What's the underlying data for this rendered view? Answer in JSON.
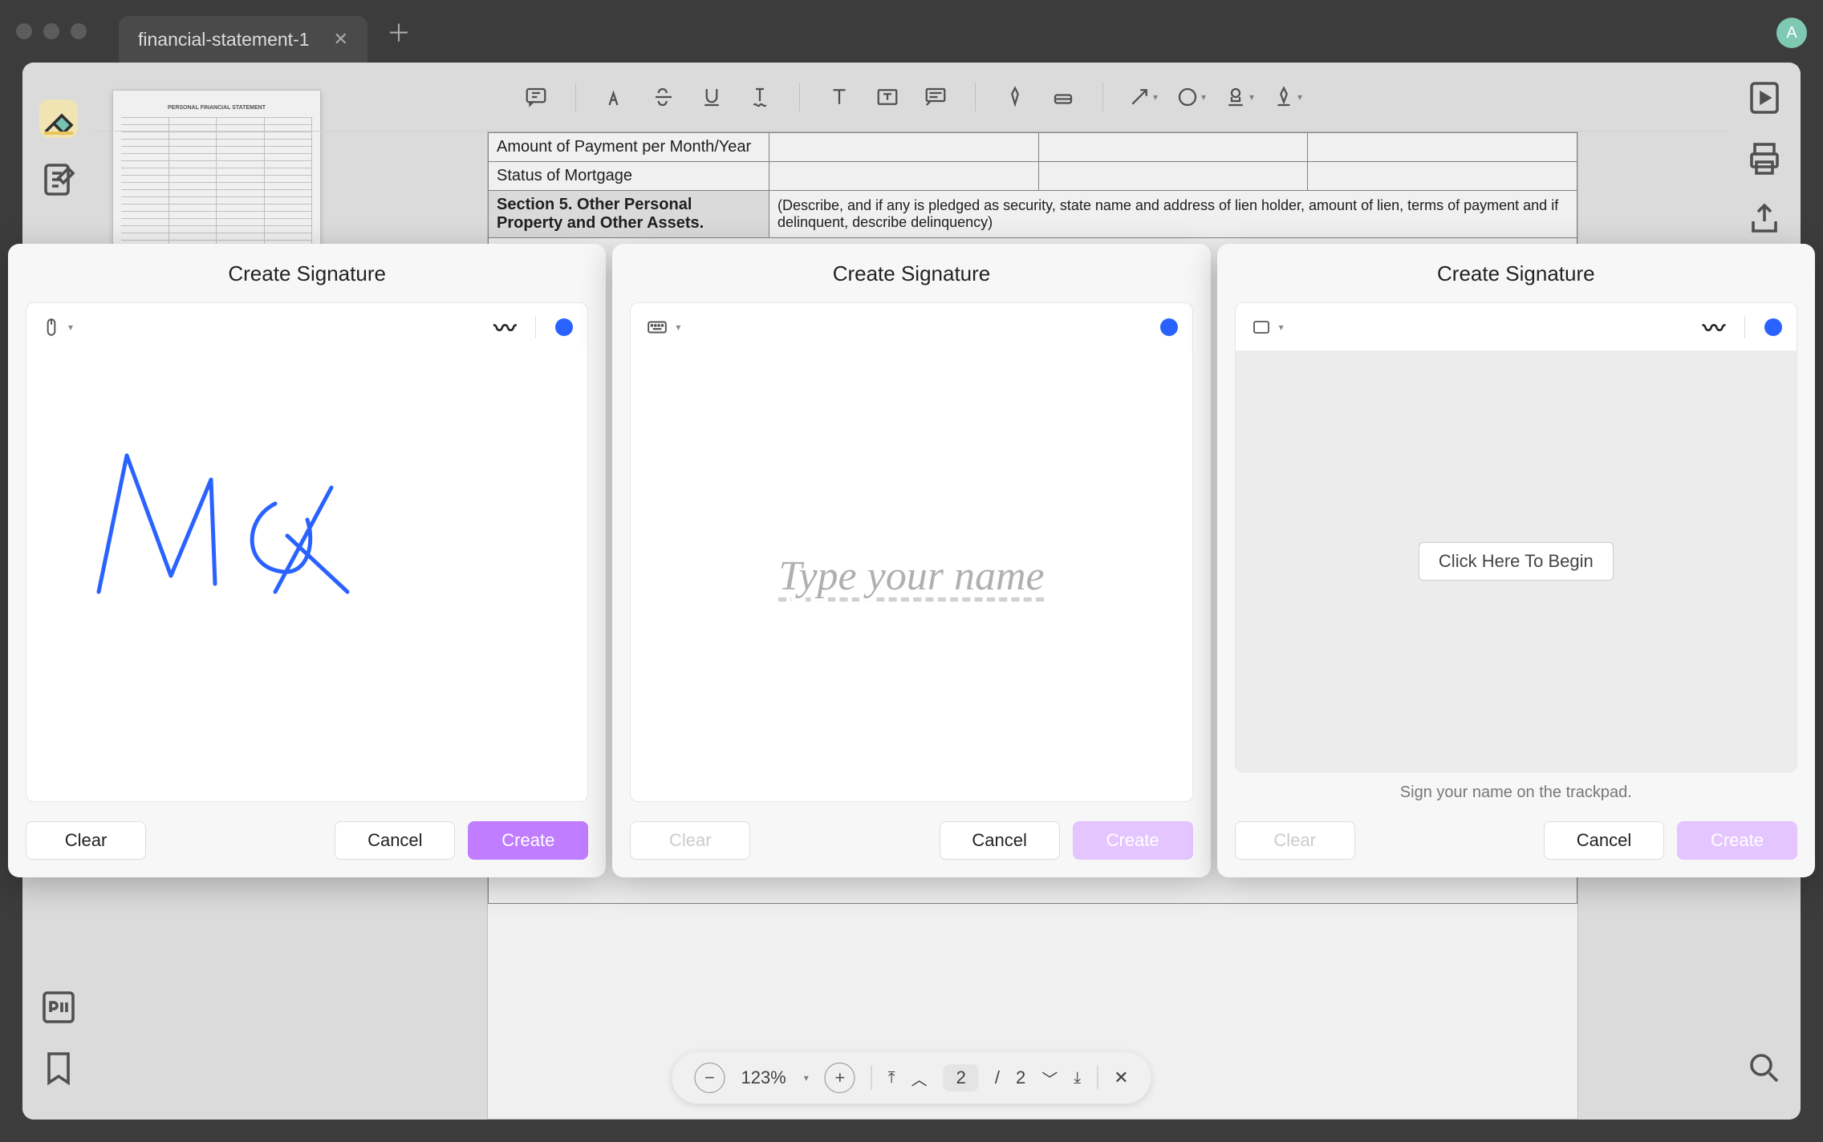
{
  "window": {
    "tab_title": "financial-statement-1",
    "avatar_letter": "A"
  },
  "document": {
    "rows": [
      "Amount of Payment per Month/Year",
      "Status of Mortgage"
    ],
    "section_title": "Section 5. Other Personal Property and Other Assets.",
    "section_desc": "(Describe, and if any is pledged as security, state name and address of lien holder, amount of lien, terms of payment and if delinquent, describe delinquency)"
  },
  "signature_dialogs": {
    "draw": {
      "title": "Create Signature",
      "signature_text": "Mark",
      "buttons": {
        "clear": "Clear",
        "cancel": "Cancel",
        "create": "Create"
      },
      "color": "#2962ff"
    },
    "type": {
      "title": "Create Signature",
      "placeholder": "Type your name",
      "buttons": {
        "clear": "Clear",
        "cancel": "Cancel",
        "create": "Create"
      },
      "color": "#2962ff"
    },
    "trackpad": {
      "title": "Create Signature",
      "begin_label": "Click Here To Begin",
      "hint": "Sign your name on the trackpad.",
      "buttons": {
        "clear": "Clear",
        "cancel": "Cancel",
        "create": "Create"
      },
      "color": "#2962ff"
    }
  },
  "bottom_bar": {
    "zoom": "123%",
    "page_current": "2",
    "page_sep": "/",
    "page_total": "2"
  }
}
